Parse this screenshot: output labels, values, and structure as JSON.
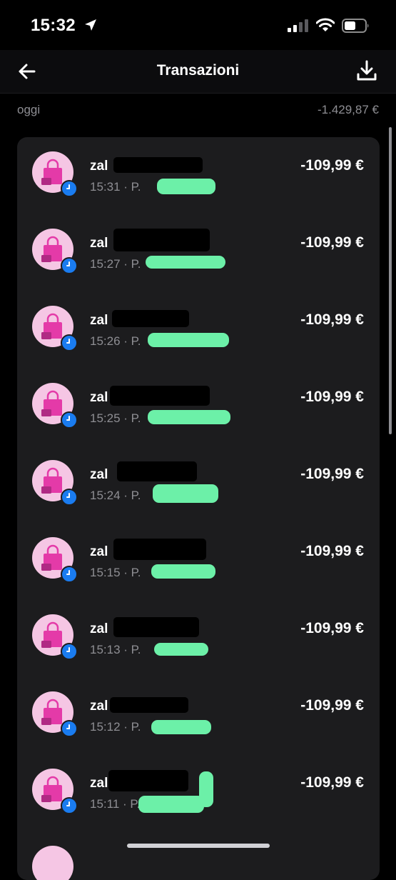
{
  "status_bar": {
    "time": "15:32",
    "icons": [
      "location-arrow-icon",
      "cellular-signal-icon",
      "wifi-icon",
      "battery-icon"
    ]
  },
  "nav": {
    "title": "Transazioni",
    "back_icon": "arrow-left-icon",
    "download_icon": "download-icon"
  },
  "section": {
    "label": "oggi",
    "total": "-1.429,87 €"
  },
  "colors": {
    "background": "#000000",
    "card": "#1c1c1e",
    "secondary_text": "#8e8e93",
    "avatar_bg": "#f5c6e4",
    "bag_pink": "#e43aa8",
    "pending_blue": "#1a7cf0",
    "redaction_green": "#6cf0a8"
  },
  "transactions": [
    {
      "merchant": "zal",
      "time": "15:31",
      "meta": "15:31 · P.",
      "amount": "-109,99 €",
      "icon": "shopping-bag-icon",
      "status_icon": "clock-icon"
    },
    {
      "merchant": "zal",
      "time": "15:27",
      "meta": "15:27 · P.",
      "amount": "-109,99 €",
      "icon": "shopping-bag-icon",
      "status_icon": "clock-icon"
    },
    {
      "merchant": "zal",
      "time": "15:26",
      "meta": "15:26 · P.",
      "amount": "-109,99 €",
      "icon": "shopping-bag-icon",
      "status_icon": "clock-icon"
    },
    {
      "merchant": "zal",
      "time": "15:25",
      "meta": "15:25 · P.",
      "amount": "-109,99 €",
      "icon": "shopping-bag-icon",
      "status_icon": "clock-icon"
    },
    {
      "merchant": "zal",
      "time": "15:24",
      "meta": "15:24 · P.",
      "amount": "-109,99 €",
      "icon": "shopping-bag-icon",
      "status_icon": "clock-icon"
    },
    {
      "merchant": "zal",
      "time": "15:15",
      "meta": "15:15 · P.",
      "amount": "-109,99 €",
      "icon": "shopping-bag-icon",
      "status_icon": "clock-icon"
    },
    {
      "merchant": "zal",
      "time": "15:13",
      "meta": "15:13 · P.",
      "amount": "-109,99 €",
      "icon": "shopping-bag-icon",
      "status_icon": "clock-icon"
    },
    {
      "merchant": "zal",
      "time": "15:12",
      "meta": "15:12 · P.",
      "amount": "-109,99 €",
      "icon": "shopping-bag-icon",
      "status_icon": "clock-icon"
    },
    {
      "merchant": "zal",
      "time": "15:11",
      "meta": "15:11 · P.",
      "amount": "-109,99 €",
      "icon": "shopping-bag-icon",
      "status_icon": "clock-icon"
    }
  ]
}
